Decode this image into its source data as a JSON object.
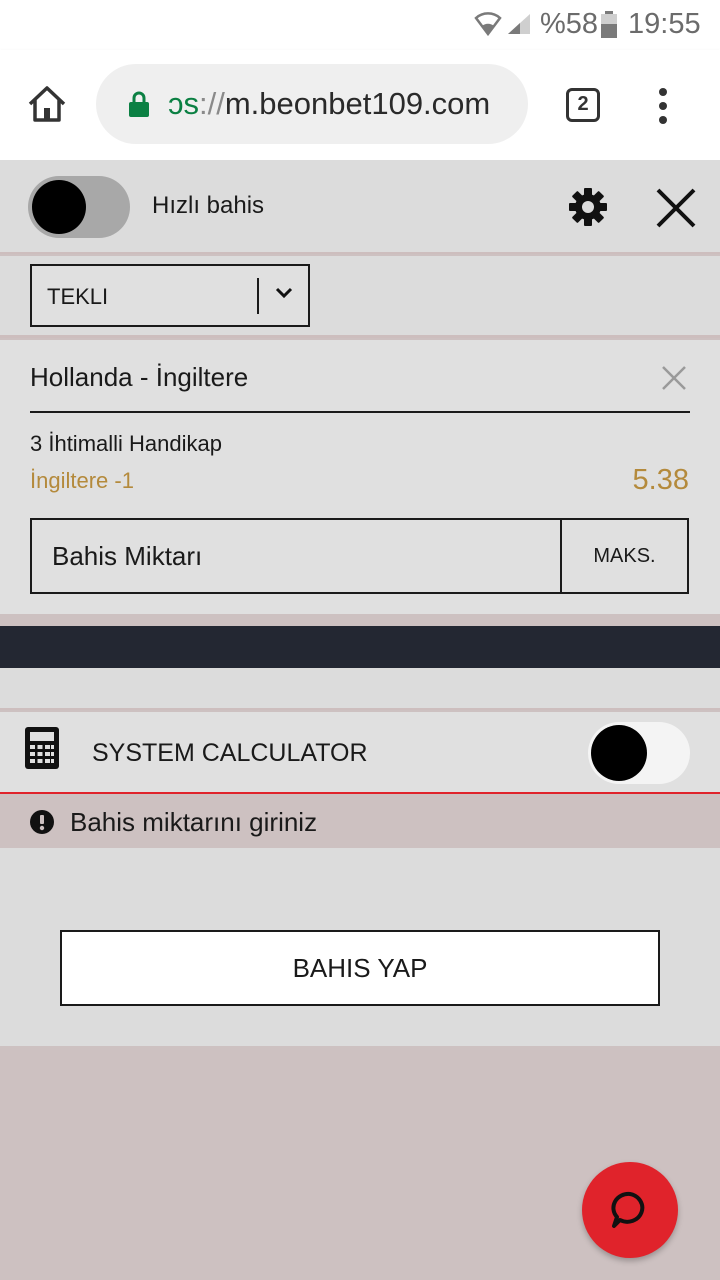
{
  "status_bar": {
    "battery_text": "%58",
    "clock": "19:55"
  },
  "browser": {
    "url_scheme": "ɔs",
    "url_sep": "://",
    "url_host": "m.beonbet109.com",
    "tab_count": "2",
    "secure_color": "#0b8043"
  },
  "betslip": {
    "quick_bet_label": "Hızlı bahis",
    "bet_type": "TEKLI",
    "match": "Hollanda - İngiltere",
    "market": "3 İhtimalli Handikap",
    "selection": "İngiltere -1",
    "odds": "5.38",
    "stake_placeholder": "Bahis Miktarı",
    "max_label": "MAKS.",
    "system_calculator_label": "SYSTEM CALCULATOR",
    "warning": "Bahis miktarını giriniz",
    "place_bet_label": "BAHIS YAP"
  },
  "colors": {
    "odds": "#b48a3c",
    "accent_red": "#e0232b",
    "dark_bar": "#232732"
  },
  "icons": [
    "wifi-icon",
    "signal-icon",
    "battery-icon",
    "home-icon",
    "lock-icon",
    "tabs-icon",
    "more-vert-icon",
    "gear-icon",
    "close-icon",
    "chevron-down-icon",
    "remove-icon",
    "calculator-icon",
    "exclamation-icon",
    "chat-icon"
  ]
}
